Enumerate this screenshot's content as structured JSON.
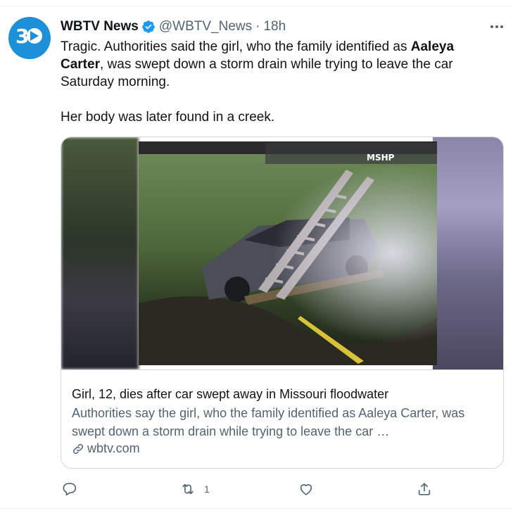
{
  "tweet": {
    "author_name": "WBTV News",
    "handle": "@WBTV_News",
    "separator": "·",
    "time": "18h",
    "avatar_text": "3",
    "text_part1": "Tragic. Authorities said the girl, who the family identified as ",
    "text_bold": "Aaleya Carter",
    "text_part2": ", was swept down a storm drain while trying to leave the car Saturday morning.",
    "text_para2": "Her body was later found in a creek."
  },
  "card": {
    "image_watermark": "MSHP",
    "title": "Girl, 12, dies after car swept away in Missouri floodwater",
    "description": "Authorities say the girl, who the family identified as Aaleya Carter, was swept down a storm drain while trying to leave the car …",
    "domain": "wbtv.com"
  },
  "actions": {
    "reply_icon": "reply-icon",
    "retweet_icon": "retweet-icon",
    "retweet_count": "1",
    "like_icon": "heart-icon",
    "share_icon": "share-icon"
  },
  "colors": {
    "verified": "#1d9bf0",
    "secondary_text": "#536471",
    "avatar_bg": "#1e90d8"
  }
}
